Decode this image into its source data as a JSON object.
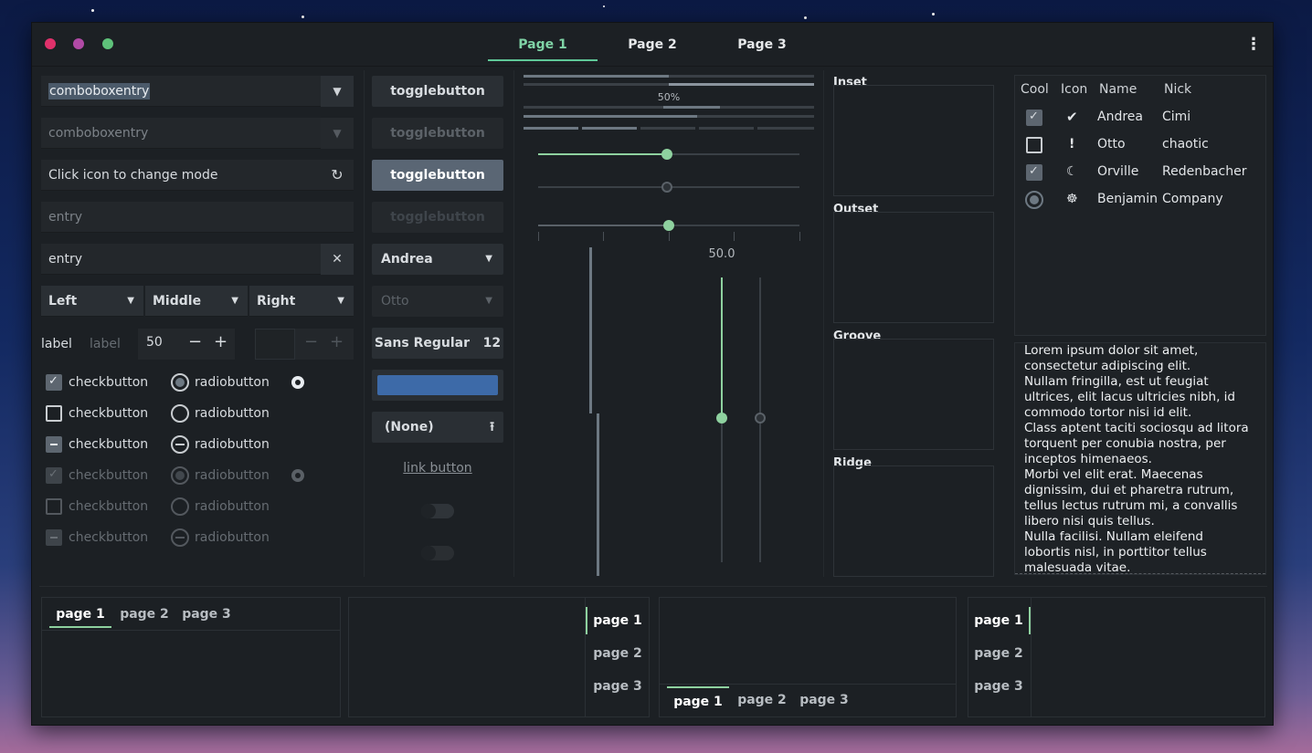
{
  "header": {
    "tabs": [
      {
        "label": "Page 1",
        "active": true
      },
      {
        "label": "Page 2",
        "active": false
      },
      {
        "label": "Page 3",
        "active": false
      }
    ],
    "window_buttons": {
      "close": "#e0316b",
      "minimize": "#b14aa6",
      "maximize": "#5ec27a"
    },
    "menu_icon": "⋮"
  },
  "col1": {
    "combo1": "comboboxentry",
    "combo2": "comboboxentry",
    "icon_entry": "Click icon to change mode",
    "entry_dim": "entry",
    "entry_clear": "entry",
    "segments": [
      "Left",
      "Middle",
      "Right"
    ],
    "label1": "label",
    "label2": "label",
    "spin_value": "50",
    "checks": [
      {
        "label": "checkbutton",
        "state": "checked"
      },
      {
        "label": "checkbutton",
        "state": "unchecked"
      },
      {
        "label": "checkbutton",
        "state": "mixed"
      },
      {
        "label": "checkbutton",
        "state": "checked-disabled"
      },
      {
        "label": "checkbutton",
        "state": "unchecked-disabled"
      },
      {
        "label": "checkbutton",
        "state": "mixed-disabled"
      }
    ],
    "radios": [
      {
        "label": "radiobutton",
        "state": "checked"
      },
      {
        "label": "radiobutton",
        "state": "unchecked"
      },
      {
        "label": "radiobutton",
        "state": "mixed"
      },
      {
        "label": "radiobutton",
        "state": "checked-disabled"
      },
      {
        "label": "radiobutton",
        "state": "unchecked-disabled"
      },
      {
        "label": "radiobutton",
        "state": "mixed-disabled"
      }
    ]
  },
  "col2": {
    "toggle1": "togglebutton",
    "toggle2": "togglebutton",
    "toggle3": "togglebutton",
    "toggle4": "togglebutton",
    "combo_andrea": "Andrea",
    "combo_otto": "Otto",
    "font_name": "Sans Regular",
    "font_size": "12",
    "color_button": "#3d6aa8",
    "file_button": "(None)",
    "link_button": "link button"
  },
  "col3": {
    "progress_label": "50%",
    "progress_value": 0.5,
    "scale_value_label": "50.0",
    "accent": "#8ed19f"
  },
  "frames": [
    "Inset",
    "Outset",
    "Groove",
    "Ridge"
  ],
  "treeview": {
    "headers": [
      "Cool",
      "Icon",
      "Name",
      "Nick"
    ],
    "rows": [
      {
        "cool": "checked",
        "icon": "✔",
        "icon_name": "check-circle-icon",
        "name": "Andrea",
        "nick": "Cimi"
      },
      {
        "cool": "unchecked",
        "icon": "!",
        "icon_name": "alert-icon",
        "name": "Otto",
        "nick": "chaotic"
      },
      {
        "cool": "checked",
        "icon": "☾",
        "icon_name": "moon-icon",
        "name": "Orville",
        "nick": "Redenbacher"
      },
      {
        "cool": "radio",
        "icon": "☸",
        "icon_name": "face-icon",
        "name": "Benjamin",
        "nick": "Company"
      }
    ]
  },
  "textview": {
    "lines": [
      "Lorem ipsum dolor sit amet,",
      "consectetur adipiscing elit.",
      "Nullam fringilla, est ut feugiat",
      "ultrices, elit lacus ultricies nibh, id",
      "commodo tortor nisi id elit.",
      "Class aptent taciti sociosqu ad litora",
      "torquent per conubia nostra, per",
      "inceptos himenaeos.",
      "Morbi vel elit erat. Maecenas",
      "dignissim, dui et pharetra rutrum,",
      "tellus lectus rutrum mi, a convallis",
      "libero nisi quis tellus.",
      "Nulla facilisi. Nullam eleifend",
      "lobortis nisl, in porttitor tellus",
      "malesuada vitae."
    ]
  },
  "notebooks": {
    "tabs": [
      "page 1",
      "page 2",
      "page 3"
    ]
  }
}
